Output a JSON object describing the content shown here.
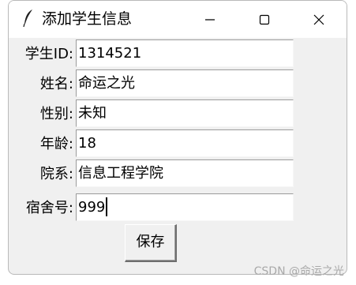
{
  "window": {
    "title": "添加学生信息",
    "minimize_symbol": "—",
    "maximize_symbol": "☐",
    "close_symbol": "✕"
  },
  "form": {
    "fields": [
      {
        "label": "学生ID:",
        "value": "1314521"
      },
      {
        "label": "姓名:",
        "value": "命运之光"
      },
      {
        "label": "性别:",
        "value": "未知"
      },
      {
        "label": "年龄:",
        "value": "18"
      },
      {
        "label": "院系:",
        "value": "信息工程学院"
      },
      {
        "label": "宿舍号:",
        "value": "999"
      }
    ]
  },
  "save_button": {
    "label": "保存"
  },
  "watermark": "CSDN @命运之光",
  "icons": {
    "app": "feather-icon",
    "minimize": "minimize-icon",
    "maximize": "maximize-icon",
    "close": "close-icon"
  }
}
